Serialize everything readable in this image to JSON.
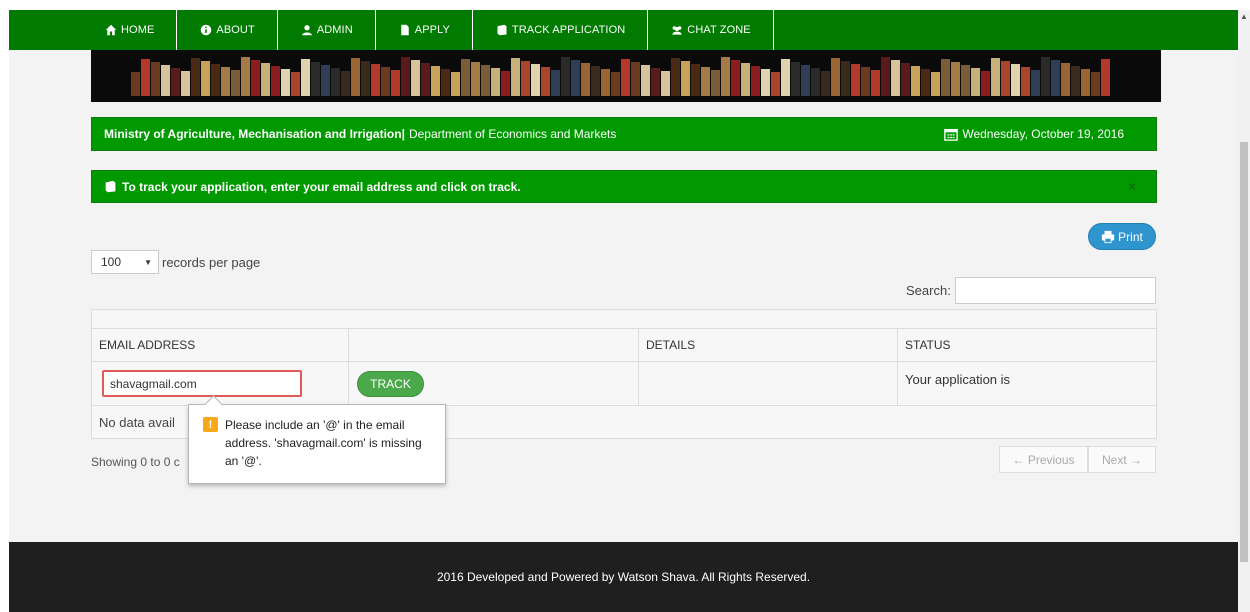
{
  "nav": {
    "items": [
      {
        "label": "HOME",
        "icon": "home-icon"
      },
      {
        "label": "ABOUT",
        "icon": "info-icon"
      },
      {
        "label": "ADMIN",
        "icon": "user-icon"
      },
      {
        "label": "APPLY",
        "icon": "file-icon"
      },
      {
        "label": "TRACK APPLICATION",
        "icon": "book-icon"
      },
      {
        "label": "CHAT ZONE",
        "icon": "users-icon"
      }
    ],
    "color": "#007a00"
  },
  "header": {
    "ministry": "Ministry of Agriculture, Mechanisation and Irrigation|",
    "department": "Department of Economics and Markets",
    "date": "Wednesday, October 19, 2016",
    "date_icon": "calendar-icon"
  },
  "alert": {
    "message": "To track your application, enter your email address and click on track.",
    "close": "×",
    "icon": "book-icon"
  },
  "toolbar": {
    "print_label": "Print",
    "print_icon": "print-icon",
    "length_value": "100",
    "length_label": "records per page",
    "search_label": "Search:",
    "search_value": ""
  },
  "table": {
    "headers": [
      "EMAIL ADDRESS",
      "",
      "DETAILS",
      "STATUS"
    ],
    "email_value": "shavagmail.com",
    "track_label": "TRACK",
    "status_text": "Your application is",
    "no_data": "No data avail",
    "showing": "Showing 0 to 0 c"
  },
  "tooltip": {
    "icon": "warning-icon",
    "text": "Please include an '@' in the email address. 'shavagmail.com' is missing an '@'."
  },
  "pager": {
    "previous": "← Previous",
    "next": "Next →"
  },
  "footer": {
    "text": "2016 Developed and Powered by Watson Shava. All Rights Reserved."
  },
  "colors": {
    "green": "#009a00",
    "accent_blue": "#2e95cf",
    "error_red": "#e05a5a",
    "footer_bg": "#1f1f1f"
  }
}
